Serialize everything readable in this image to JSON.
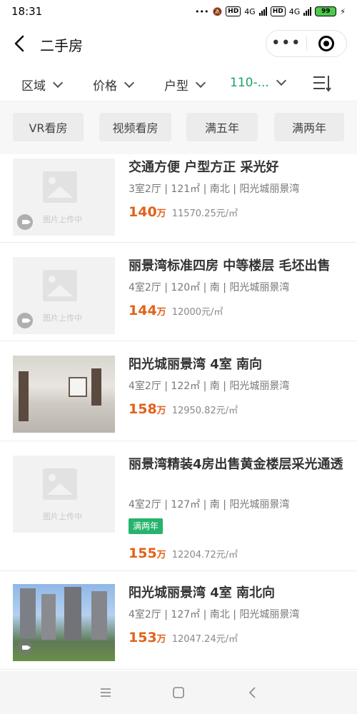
{
  "status": {
    "time": "18:31",
    "hd": "HD",
    "net": "4G",
    "battery": "99"
  },
  "nav": {
    "title": "二手房"
  },
  "filters": [
    {
      "label": "区域"
    },
    {
      "label": "价格"
    },
    {
      "label": "户型"
    },
    {
      "label": "110-..."
    }
  ],
  "colors": {
    "accent": "#1ea065",
    "price": "#e0621a",
    "tag": "#26b36e"
  },
  "tags": [
    "VR看房",
    "视频看房",
    "满五年",
    "满两年"
  ],
  "placeholder_text": "图片上传中",
  "listings": [
    {
      "title": "交通方便 户型方正 采光好",
      "meta": "3室2厅 | 121㎡ | 南北 | 阳光城丽景湾",
      "price": "140",
      "price_unit": "万",
      "unit_price": "11570.25元/㎡",
      "image": "placeholder",
      "video": true
    },
    {
      "title": "丽景湾标准四房 中等楼层 毛坯出售",
      "meta": "4室2厅 | 120㎡ | 南 | 阳光城丽景湾",
      "price": "144",
      "price_unit": "万",
      "unit_price": "12000元/㎡",
      "image": "placeholder",
      "video": true
    },
    {
      "title": "阳光城丽景湾 4室 南向",
      "meta": "4室2厅 | 122㎡ | 南 | 阳光城丽景湾",
      "price": "158",
      "price_unit": "万",
      "unit_price": "12950.82元/㎡",
      "image": "interior-photo",
      "video": false
    },
    {
      "title": "丽景湾精装4房出售黄金楼层采光通透",
      "meta": "4室2厅 | 127㎡ | 南 | 阳光城丽景湾",
      "tag": "满两年",
      "price": "155",
      "price_unit": "万",
      "unit_price": "12204.72元/㎡",
      "image": "placeholder",
      "video": false
    },
    {
      "title": "阳光城丽景湾 4室 南北向",
      "meta": "4室2厅 | 127㎡ | 南北 | 阳光城丽景湾",
      "price": "153",
      "price_unit": "万",
      "unit_price": "12047.24元/㎡",
      "image": "building-photo",
      "video": true
    }
  ]
}
